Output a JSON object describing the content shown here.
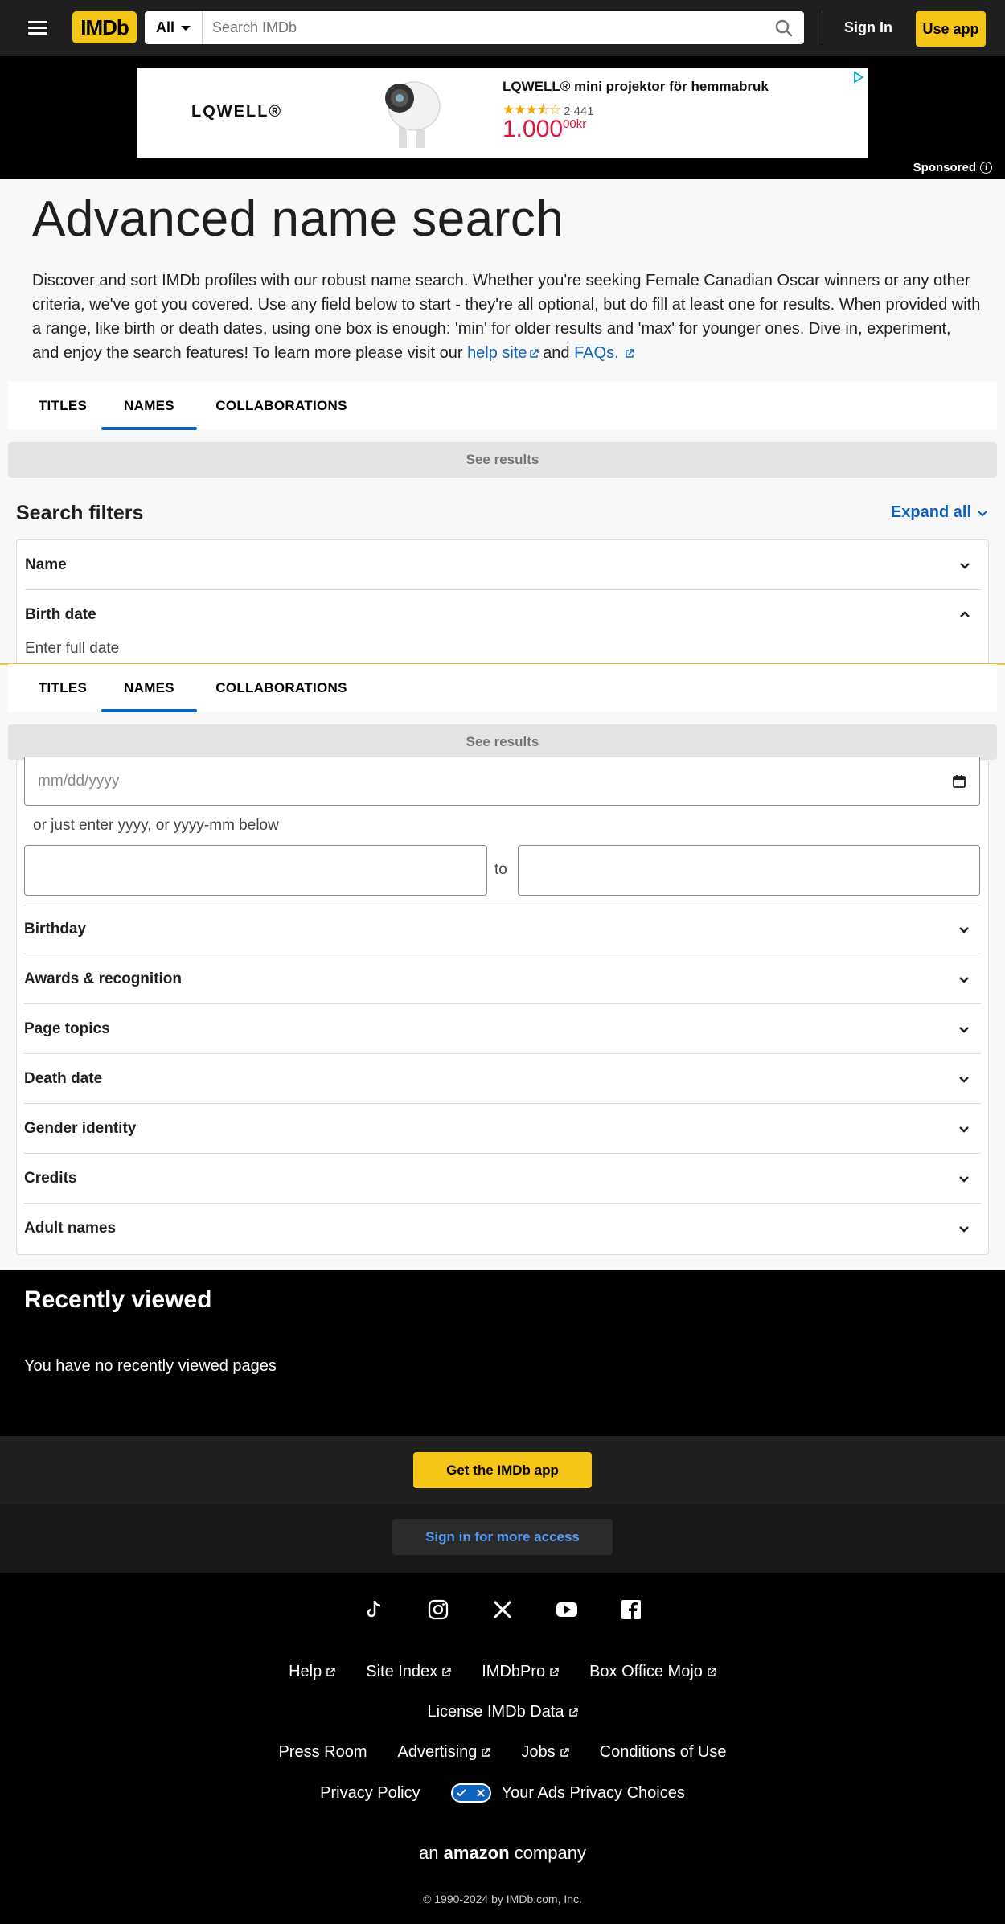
{
  "header": {
    "logo": "IMDb",
    "search_category": "All",
    "search_placeholder": "Search IMDb",
    "sign_in": "Sign In",
    "use_app": "Use app"
  },
  "ad": {
    "brand": "LQWELL®",
    "title": "LQWELL® mini projektor för hemmabruk",
    "rating_count": "2 441",
    "stars": 3.5,
    "price_main": "1.000",
    "price_sup": "00kr",
    "sponsored": "Sponsored"
  },
  "page": {
    "title": "Advanced name search",
    "intro": "Discover and sort IMDb profiles with our robust name search. Whether you're seeking Female Canadian Oscar winners or any other criteria, we've got you covered. Use any field below to start - they're all optional, but do fill at least one for results. When provided with a range, like birth or death dates, using one box is enough: 'min' for older results and 'max' for younger ones. Dive in, experiment, and enjoy the search features! To learn more please visit our",
    "help_link": "help site",
    "and": "and",
    "faq_link": "FAQs."
  },
  "tabs": [
    {
      "label": "TITLES"
    },
    {
      "label": "NAMES",
      "active": true
    },
    {
      "label": "COLLABORATIONS"
    }
  ],
  "see_results": "See results",
  "filters": {
    "title": "Search filters",
    "expand_all": "Expand all",
    "name": "Name",
    "birth_date": "Birth date",
    "enter_full_date": "Enter full date",
    "date_placeholder": "mm/dd/yyyy",
    "or_just": "or just enter yyyy, or yyyy-mm below",
    "to": "to",
    "rest": [
      "Birthday",
      "Awards & recognition",
      "Page topics",
      "Death date",
      "Gender identity",
      "Credits",
      "Adult names"
    ]
  },
  "recent": {
    "title": "Recently viewed",
    "empty": "You have no recently viewed pages"
  },
  "app": {
    "get_app": "Get the IMDb app",
    "sign_in_more": "Sign in for more access"
  },
  "footer": {
    "row1": [
      "Help",
      "Site Index",
      "IMDbPro",
      "Box Office Mojo"
    ],
    "row2": [
      "License IMDb Data"
    ],
    "row3": [
      "Press Room",
      "Advertising",
      "Jobs",
      "Conditions of Use"
    ],
    "privacy": "Privacy Policy",
    "ads_choices": "Your Ads Privacy Choices",
    "amazon_an": "an",
    "amazon_word": "amazon",
    "amazon_company": "company",
    "copyright": "© 1990-2024 by IMDb.com, Inc."
  }
}
